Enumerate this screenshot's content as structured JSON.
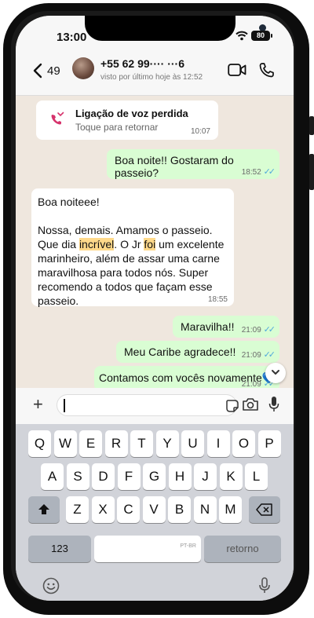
{
  "status": {
    "time": "13:00",
    "battery": "80"
  },
  "header": {
    "unread_count": "49",
    "contact": "+55 62 99···· ···6",
    "last_seen": "visto por último hoje às 12:52"
  },
  "missed_call": {
    "title": "Ligação de voz perdida",
    "subtitle": "Toque para retornar",
    "time": "10:07"
  },
  "messages": [
    {
      "text": "Boa noite!! Gostaram do passeio?",
      "time": "18:52"
    },
    {
      "line1": "Boa noiteee!",
      "p2a": "Nossa, demais. Amamos o passeio. Que dia ",
      "hl1": "incrível",
      "p2b": ". O Jr ",
      "hl2": "foi",
      "p2c": " um excelente marinheiro, além de assar uma carne maravilhosa para todos nós. Super recomendo a todos que façam esse passeio.",
      "time": "18:55"
    },
    {
      "text": "Maravilha!!",
      "time": "21:09"
    },
    {
      "text": "Meu Caribe agradece!!",
      "time": "21:09"
    },
    {
      "text": "Contamos com vocês novamente💙",
      "time": "21:09"
    }
  ],
  "keyboard": {
    "row1": [
      "Q",
      "W",
      "E",
      "R",
      "T",
      "Y",
      "U",
      "I",
      "O",
      "P"
    ],
    "row2": [
      "A",
      "S",
      "D",
      "F",
      "G",
      "H",
      "J",
      "K",
      "L"
    ],
    "row3": [
      "Z",
      "X",
      "C",
      "V",
      "B",
      "N",
      "M"
    ],
    "numbers_key": "123",
    "space_hint": "PT-BR",
    "return_key": "retorno"
  },
  "icons": {
    "back": "chevron-left-icon",
    "video": "video-call-icon",
    "call": "phone-icon",
    "missed": "missed-call-icon",
    "plus": "plus-icon",
    "sticker": "sticker-icon",
    "camera": "camera-icon",
    "mic": "microphone-icon",
    "shift": "shift-icon",
    "backspace": "backspace-icon",
    "emoji": "emoji-icon",
    "dictation": "dictation-mic-icon"
  },
  "colors": {
    "incoming_bubble": "#ffffff",
    "outgoing_bubble": "#d9fdd3",
    "read_ticks": "#4fa8dc",
    "highlight": "#ffd98a"
  }
}
